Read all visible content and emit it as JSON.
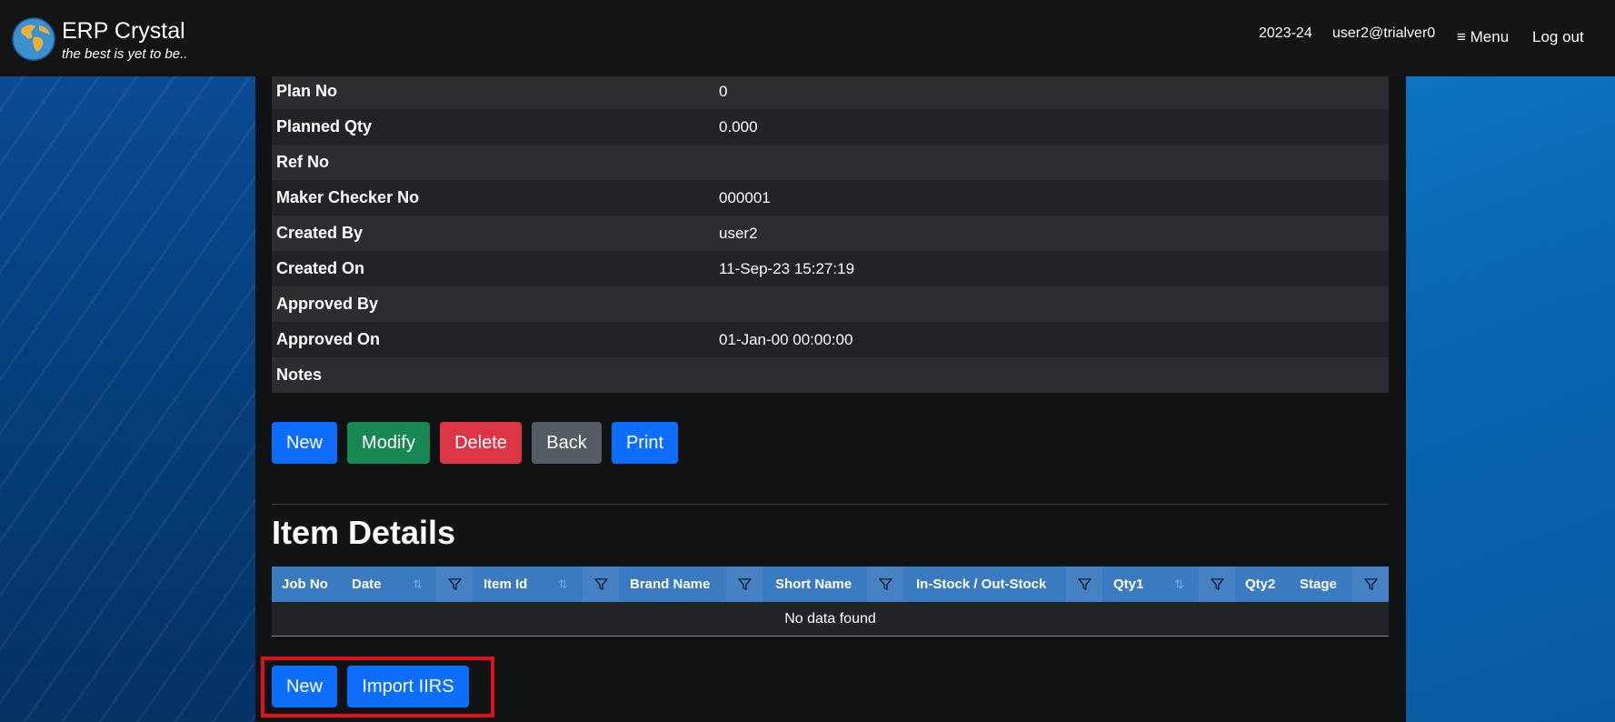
{
  "header": {
    "brand_title": "ERP Crystal",
    "brand_tagline": "the best is yet to be..",
    "fiscal_year": "2023-24",
    "user": "user2@trialver0",
    "menu_label": "≡ Menu",
    "logout_label": "Log out"
  },
  "details": [
    {
      "label": "Plan No",
      "value": "0"
    },
    {
      "label": "Planned Qty",
      "value": "0.000"
    },
    {
      "label": "Ref No",
      "value": ""
    },
    {
      "label": "Maker Checker No",
      "value": "000001"
    },
    {
      "label": "Created By",
      "value": "user2"
    },
    {
      "label": "Created On",
      "value": "11-Sep-23 15:27:19"
    },
    {
      "label": "Approved By",
      "value": ""
    },
    {
      "label": "Approved On",
      "value": "01-Jan-00 00:00:00"
    },
    {
      "label": "Notes",
      "value": ""
    }
  ],
  "actions": {
    "new": "New",
    "modify": "Modify",
    "delete": "Delete",
    "back": "Back",
    "print": "Print"
  },
  "item_details": {
    "title": "Item Details",
    "columns": [
      "Job No",
      "Date",
      "Item Id",
      "Brand Name",
      "Short Name",
      "In-Stock / Out-Stock",
      "Qty1",
      "Qty2",
      "Stage"
    ],
    "empty_text": "No data found",
    "new_label": "New",
    "import_label": "Import IIRS"
  },
  "colors": {
    "primary": "#0d6efd",
    "success": "#198754",
    "danger": "#dc3545",
    "secondary": "#545b62",
    "grid_header": "#3a7ac0",
    "highlight": "#e0111b"
  }
}
